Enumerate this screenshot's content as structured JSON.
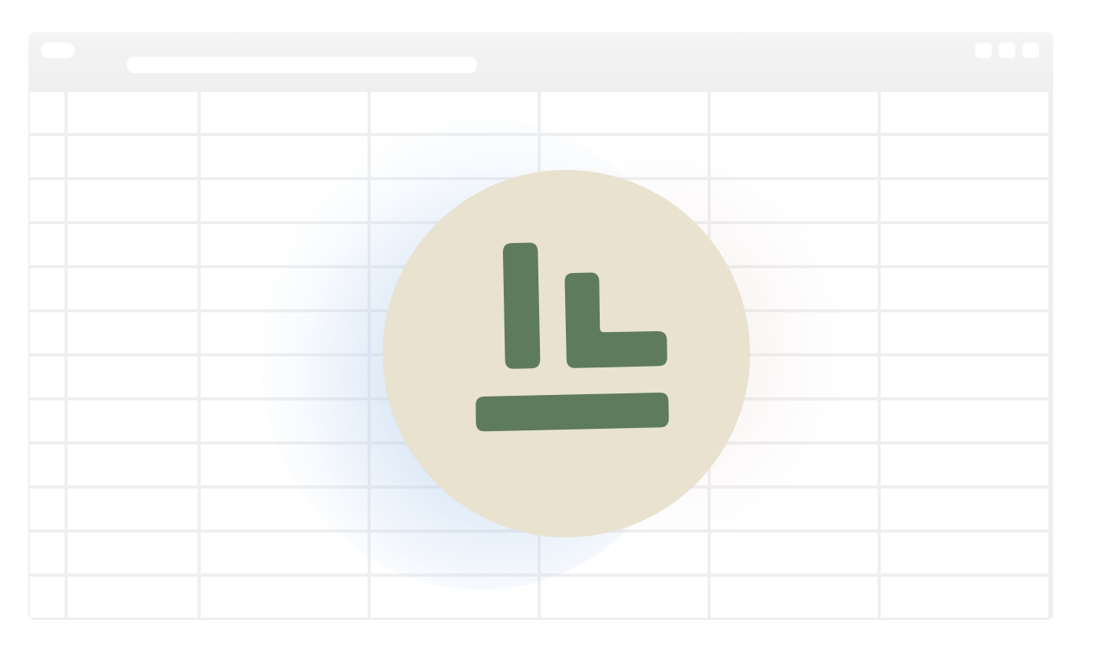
{
  "window": {
    "url": ""
  },
  "colors": {
    "logo_background": "#e8e2cf",
    "logo_mark": "#5e7b5e",
    "chrome": "#f1f1f1",
    "grid_line": "#efefef"
  },
  "icons": {
    "logo": "app-logo-icon"
  },
  "sheet": {
    "rows": 12,
    "columns": 7
  }
}
